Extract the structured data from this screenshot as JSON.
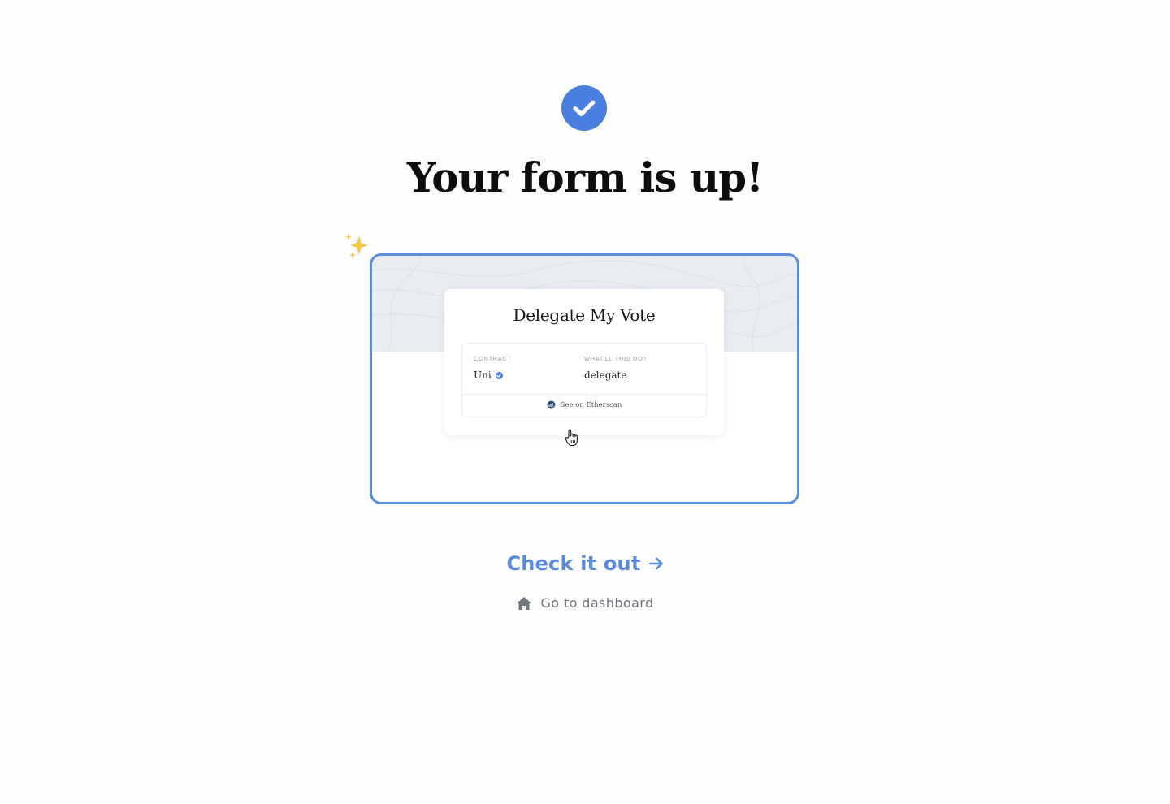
{
  "headline": "Your form is up!",
  "preview": {
    "form_title": "Delegate My Vote",
    "contract_label": "CONTRACT",
    "contract_value": "Uni",
    "action_label": "WHAT'LL THIS DO?",
    "action_value": "delegate",
    "etherscan_link": "See on Etherscan"
  },
  "actions": {
    "check_it_out": "Check it out",
    "go_to_dashboard": "Go to dashboard"
  },
  "colors": {
    "accent": "#4a7fe0",
    "link": "#5a8ad8",
    "muted": "#6f7680",
    "sparkle": "#f3c94a"
  },
  "icons": [
    "check-circle-icon",
    "sparkles-icon",
    "verified-icon",
    "etherscan-icon",
    "hand-cursor-icon",
    "arrow-right-icon",
    "home-icon"
  ]
}
